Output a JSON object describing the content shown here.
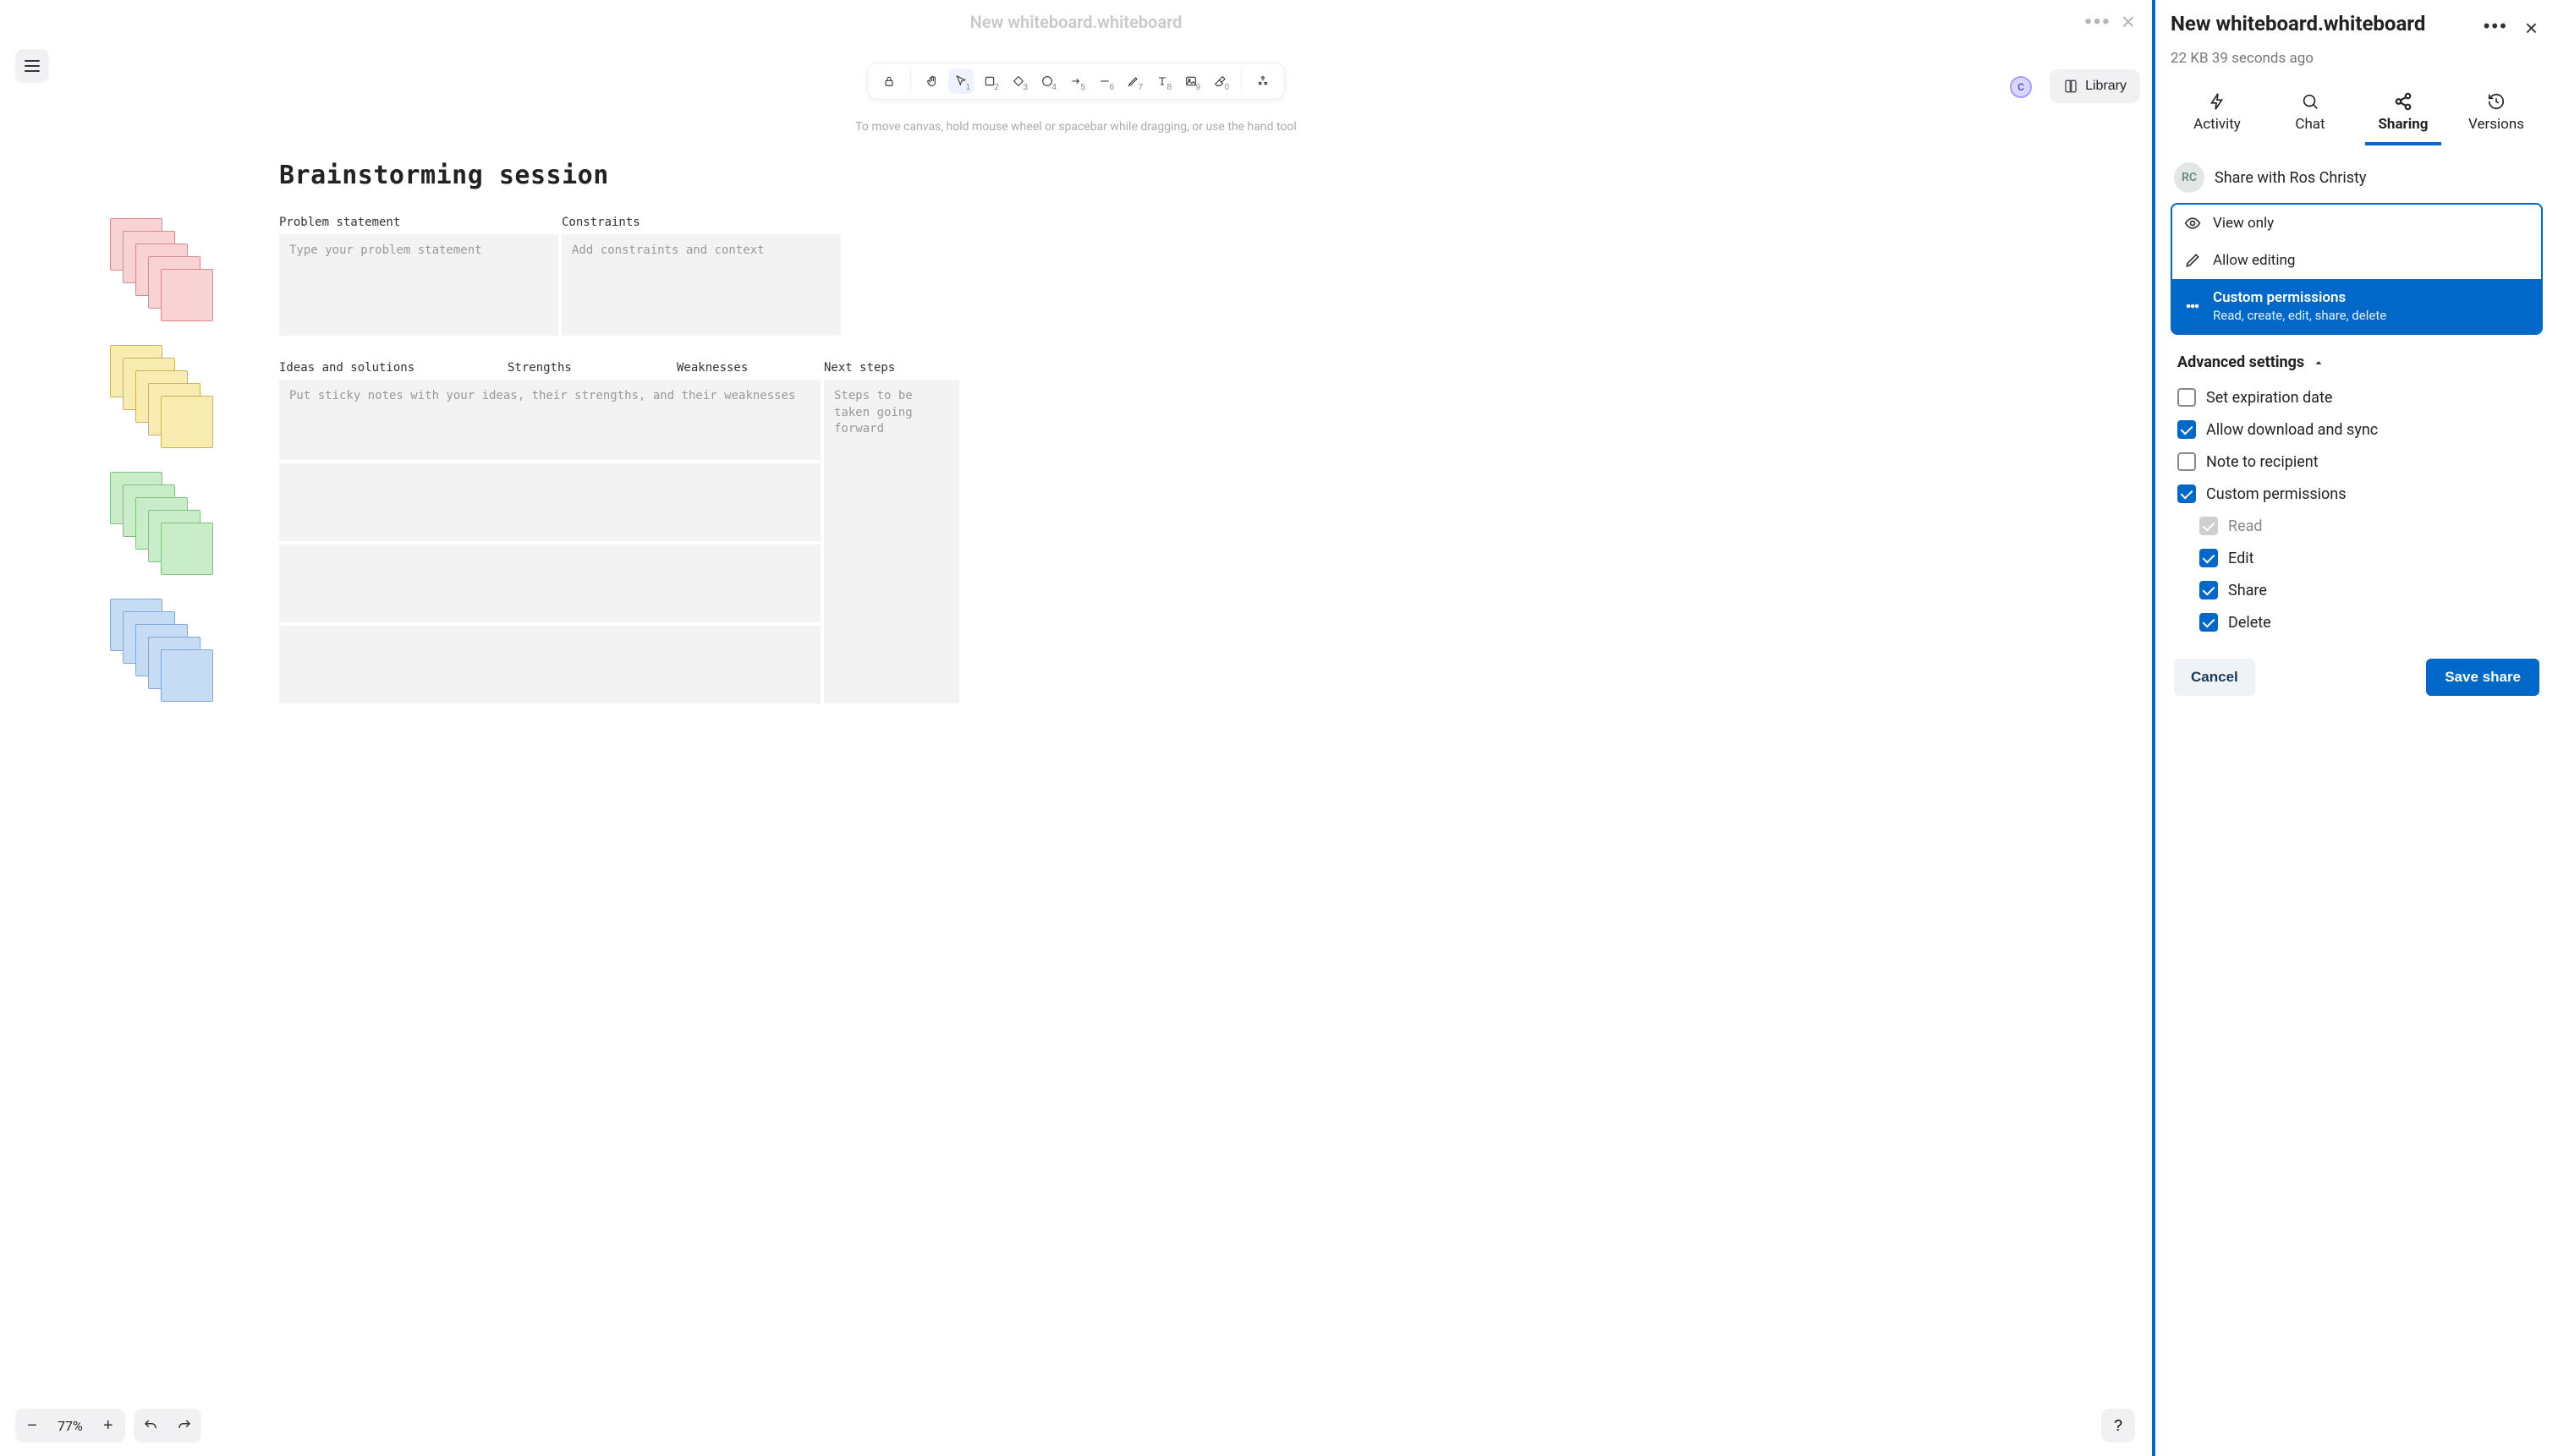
{
  "header": {
    "title": "New whiteboard.whiteboard"
  },
  "toolbar": {
    "hint": "To move canvas, hold mouse wheel or spacebar while dragging, or use the hand tool",
    "library_label": "Library",
    "zoom_pct": "77%",
    "tools": {
      "lock": "lock",
      "hand": "hand",
      "select": "1",
      "rect": "2",
      "diamond": "3",
      "circle": "4",
      "arrow": "5",
      "line": "6",
      "pencil": "7",
      "text": "8",
      "image": "9",
      "eraser": "0",
      "more": "more"
    },
    "presence_initial": "C"
  },
  "whiteboard": {
    "title": "Brainstorming session",
    "labels": {
      "problem": "Problem statement",
      "constraints": "Constraints",
      "ideas": "Ideas and solutions",
      "strengths": "Strengths",
      "weaknesses": "Weaknesses",
      "next": "Next steps"
    },
    "placeholders": {
      "problem": "Type your problem statement",
      "constraints": "Add constraints and context",
      "ideas": "Put sticky notes with your ideas, their strengths, and their weaknesses",
      "next": "Steps to be taken going forward"
    }
  },
  "sidebar": {
    "title": "New whiteboard.whiteboard",
    "meta": "22 KB 39 seconds ago",
    "tabs": {
      "activity": "Activity",
      "chat": "Chat",
      "sharing": "Sharing",
      "versions": "Versions"
    },
    "share_with_initials": "RC",
    "share_with_label": "Share with Ros Christy",
    "perm_options": {
      "view": "View only",
      "edit": "Allow editing",
      "custom_title": "Custom permissions",
      "custom_sub": "Read, create, edit, share, delete"
    },
    "advanced_label": "Advanced settings",
    "checks": {
      "expiration": "Set expiration date",
      "download": "Allow download and sync",
      "note": "Note to recipient",
      "custom": "Custom permissions",
      "read": "Read",
      "edit": "Edit",
      "share": "Share",
      "delete": "Delete"
    },
    "actions": {
      "cancel": "Cancel",
      "save": "Save share"
    }
  }
}
